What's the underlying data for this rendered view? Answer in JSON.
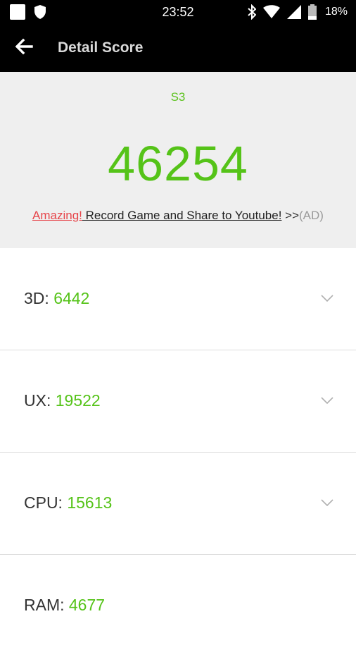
{
  "status_bar": {
    "time": "23:52",
    "battery": "18%",
    "icons": [
      "square-notification-icon",
      "shield-icon",
      "bluetooth-icon",
      "wifi-icon",
      "signal-icon",
      "battery-icon"
    ]
  },
  "app_bar": {
    "title": "Detail Score",
    "back_icon": "arrow-left-icon"
  },
  "summary": {
    "device": "S3",
    "total_score": "46254",
    "ad": {
      "highlight": "Amazing!",
      "link_text": " Record Game and Share to Youtube!",
      "arrows": " >>",
      "tag": "(AD)"
    }
  },
  "scores": [
    {
      "label": "3D: ",
      "value": "6442"
    },
    {
      "label": "UX: ",
      "value": "19522"
    },
    {
      "label": "CPU: ",
      "value": "15613"
    },
    {
      "label": "RAM: ",
      "value": "4677"
    }
  ],
  "colors": {
    "accent_green": "#55c318",
    "ad_red": "#e6454a",
    "header_bg": "#efefef",
    "bar_bg": "#000000"
  }
}
